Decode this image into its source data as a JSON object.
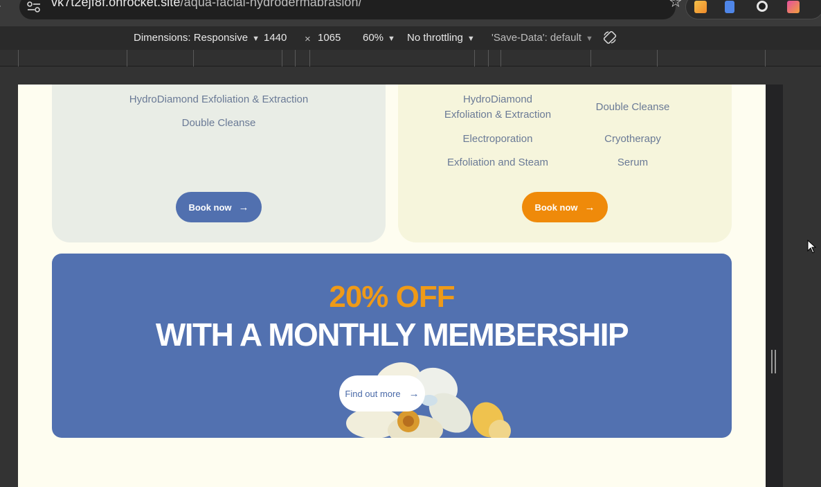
{
  "browser": {
    "url_host": "vk7t2ejf8f.onrocket.site",
    "url_path": "/aqua-facial-hydrodermabrasion/"
  },
  "device_toolbar": {
    "dimensions_label": "Dimensions: Responsive",
    "width": "1440",
    "times": "×",
    "height": "1065",
    "zoom": "60%",
    "throttling": "No throttling",
    "save_data": "'Save-Data': default"
  },
  "cards": {
    "left": {
      "services": [
        "HydroDiamond Exfoliation & Extraction",
        "Double Cleanse"
      ],
      "button_label": "Book now",
      "button_color": "#5170af",
      "background": "#e9ede6"
    },
    "right": {
      "services": [
        "HydroDiamond\nExfoliation & Extraction",
        "Double Cleanse",
        "Electroporation",
        "Cryotherapy",
        "Exfoliation and Steam",
        "Serum"
      ],
      "button_label": "Book now",
      "button_color": "#ef8a0a",
      "background": "#f6f5dc"
    }
  },
  "promo": {
    "discount": "20% OFF",
    "title": "WITH A MONTHLY MEMBERSHIP",
    "cta_label": "Find out more",
    "background": "#5271b0",
    "accent": "#ef9a18"
  }
}
